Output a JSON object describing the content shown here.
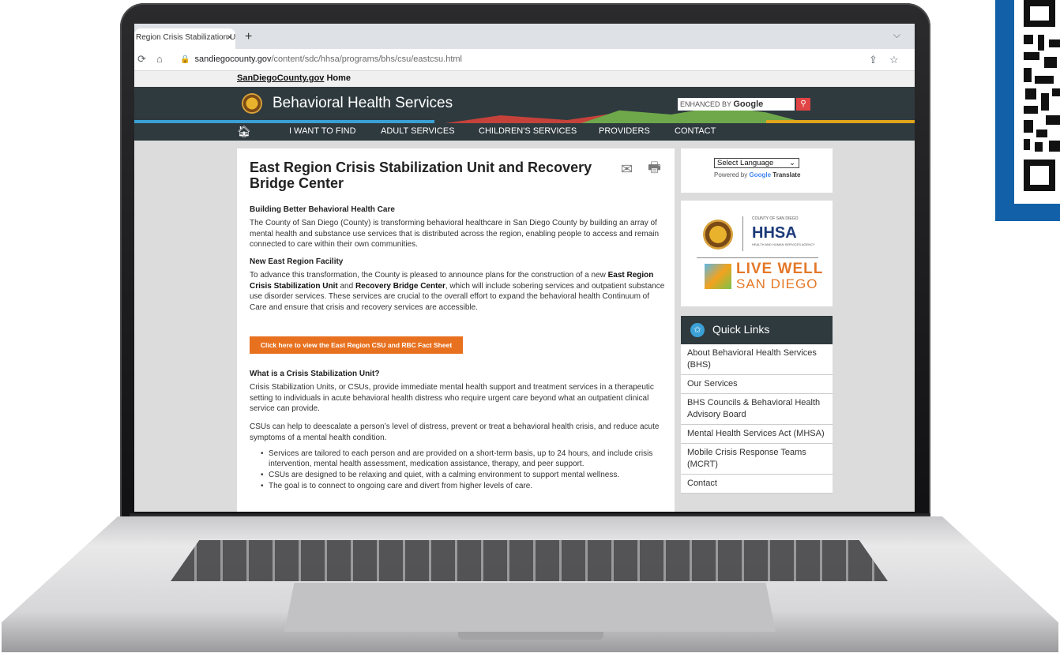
{
  "browser": {
    "tab_title": "Region Crisis Stabilization Ur",
    "tab_close": "×",
    "new_tab": "+",
    "tab_menu": "⌵",
    "url_domain": "sandiegocounty.gov",
    "url_path": "/content/sdc/hhsa/programs/bhs/csu/eastcsu.html"
  },
  "site": {
    "top_link_main": "SanDiegoCounty.gov",
    "top_link_rest": " Home",
    "title": "Behavioral Health Services",
    "search_prefix": "ENHANCED BY",
    "search_brand": "Google",
    "nav": [
      "I WANT TO FIND",
      "ADULT SERVICES",
      "CHILDREN'S SERVICES",
      "PROVIDERS",
      "CONTACT"
    ]
  },
  "main": {
    "heading": "East Region Crisis Stabilization Unit and Recovery Bridge Center",
    "s1_title": "Building Better Behavioral Health Care",
    "s1_text": "The County of San Diego (County) is transforming behavioral healthcare in San Diego County by building an array of mental health and substance use services that is distributed across the region, enabling people to access and remain connected to care within their own communities.",
    "s2_title": "New East Region Facility",
    "s2_text_a": "To advance this transformation, the County is pleased to announce plans for the construction of a new ",
    "s2_bold_a": "East Region Crisis Stabilization Unit",
    "s2_text_b": " and ",
    "s2_bold_b": "Recovery Bridge Center",
    "s2_text_c": ", which will include sobering services and outpatient substance use disorder services. These services are crucial to the overall effort to expand the behavioral health Continuum of Care and ensure that crisis and recovery services are accessible.",
    "cta": "Click here to view the East Region CSU and RBC Fact Sheet",
    "s3_title": "What is a Crisis Stabilization Unit?",
    "s3_text1": "Crisis Stabilization Units, or CSUs, provide immediate mental health support and treatment services in a therapeutic setting to individuals in acute behavioral health distress who require urgent care beyond what an outpatient clinical service can provide.",
    "s3_text2": "CSUs can help to deescalate a person’s level of distress, prevent or treat a behavioral health crisis, and reduce acute symptoms of a mental health condition.",
    "bullets": [
      "Services are tailored to each person and are provided on a short-term basis, up to 24 hours, and include crisis intervention, mental health assessment, medication assistance, therapy, and peer support.",
      "CSUs are designed to be relaxing and quiet, with a calming environment to support mental wellness.",
      "The goal is to connect to ongoing care and divert from higher levels of care."
    ]
  },
  "sidebar": {
    "language_select": "Select Language",
    "powered_prefix": "Powered by",
    "powered_google": "Google",
    "powered_translate": "Translate",
    "hhsa_top": "COUNTY OF SAN DIEGO",
    "hhsa": "HHSA",
    "hhsa_sub": "HEALTH AND HUMAN SERVICES AGENCY",
    "live_well_1": "LIVE WELL",
    "live_well_2": "SAN DIEGO",
    "quick_links_title": "Quick Links",
    "quick_links": [
      "About Behavioral Health Services (BHS)",
      "Our Services",
      "BHS Councils & Behavioral Health Advisory Board",
      "Mental Health Services Act (MHSA)",
      "Mobile Crisis Response Teams (MCRT)",
      "Contact"
    ]
  }
}
